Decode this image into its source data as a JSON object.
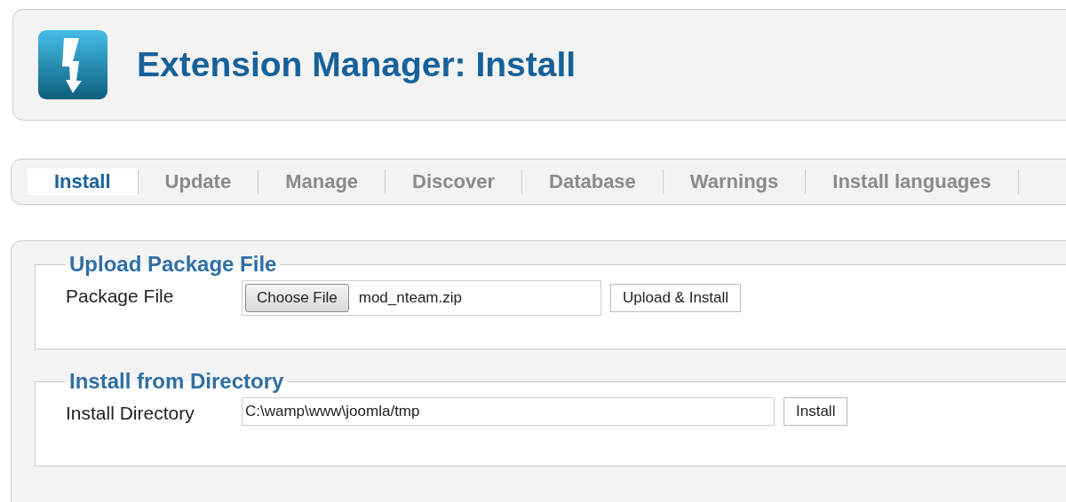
{
  "header": {
    "title": "Extension Manager: Install"
  },
  "tabs": [
    {
      "label": "Install",
      "selected": true
    },
    {
      "label": "Update",
      "selected": false
    },
    {
      "label": "Manage",
      "selected": false
    },
    {
      "label": "Discover",
      "selected": false
    },
    {
      "label": "Database",
      "selected": false
    },
    {
      "label": "Warnings",
      "selected": false
    },
    {
      "label": "Install languages",
      "selected": false
    }
  ],
  "sections": [
    {
      "legend": "Upload Package File",
      "kind": "file",
      "label": "Package File",
      "chooser": "Choose File",
      "value": "mod_nteam.zip",
      "button": "Upload & Install"
    },
    {
      "legend": "Install from Directory",
      "kind": "text",
      "label": "Install Directory",
      "value": "C:\\wamp\\www\\joomla/tmp",
      "button": "Install"
    }
  ]
}
